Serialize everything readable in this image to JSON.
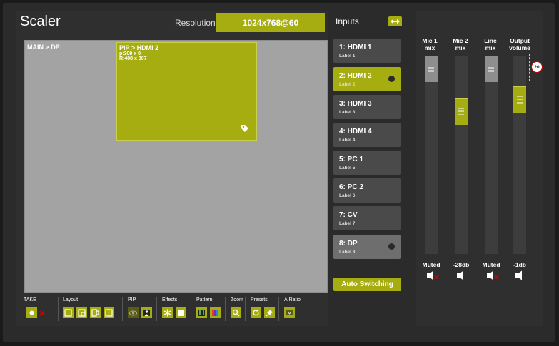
{
  "title": "Scaler",
  "resolution": {
    "label": "Resolution",
    "value": "1024x768@60"
  },
  "preview": {
    "main_label": "MAIN > DP",
    "pip": {
      "title": "PIP > HDMI 2",
      "position": "p:309 x 0",
      "resize": "R:408 x 307"
    }
  },
  "toolbar": {
    "take": "TAKE",
    "layout": "Layout",
    "pip": "PIP",
    "effects": "Effects",
    "pattern": "Pattern",
    "zoom": "Zoom",
    "presets": "Presets",
    "aratio": "A.Ratio"
  },
  "inputs": {
    "title": "Inputs",
    "items": [
      {
        "name": "1: HDMI 1",
        "label": "Label 1"
      },
      {
        "name": "2: HDMI 2",
        "label": "Label 2"
      },
      {
        "name": "3: HDMI 3",
        "label": "Label 3"
      },
      {
        "name": "4: HDMI 4",
        "label": "Label 4"
      },
      {
        "name": "5: PC 1",
        "label": "Label 5"
      },
      {
        "name": "6: PC 2",
        "label": "Label 6"
      },
      {
        "name": "7: CV",
        "label": "Label 7"
      },
      {
        "name": "8: DP",
        "label": "Label 8"
      }
    ],
    "auto_switching": "Auto Switching"
  },
  "audio": {
    "channels": [
      {
        "label_line1": "Mic 1",
        "label_line2": "mix",
        "value": "Muted",
        "level": 1.0,
        "muted": true
      },
      {
        "label_line1": "Mic 2",
        "label_line2": "mix",
        "value": "-28db",
        "level": 0.75,
        "muted": false
      },
      {
        "label_line1": "Line",
        "label_line2": "mix",
        "value": "Muted",
        "level": 1.0,
        "muted": true
      },
      {
        "label_line1": "Output",
        "label_line2": "volume",
        "value": "-1db",
        "level": 0.82,
        "muted": false
      }
    ],
    "output_badge": "20"
  },
  "colors": {
    "accent": "#a6ad10",
    "panel": "#2f2f2f",
    "button": "#4a4a4a",
    "preview": "#a3a3a3"
  }
}
